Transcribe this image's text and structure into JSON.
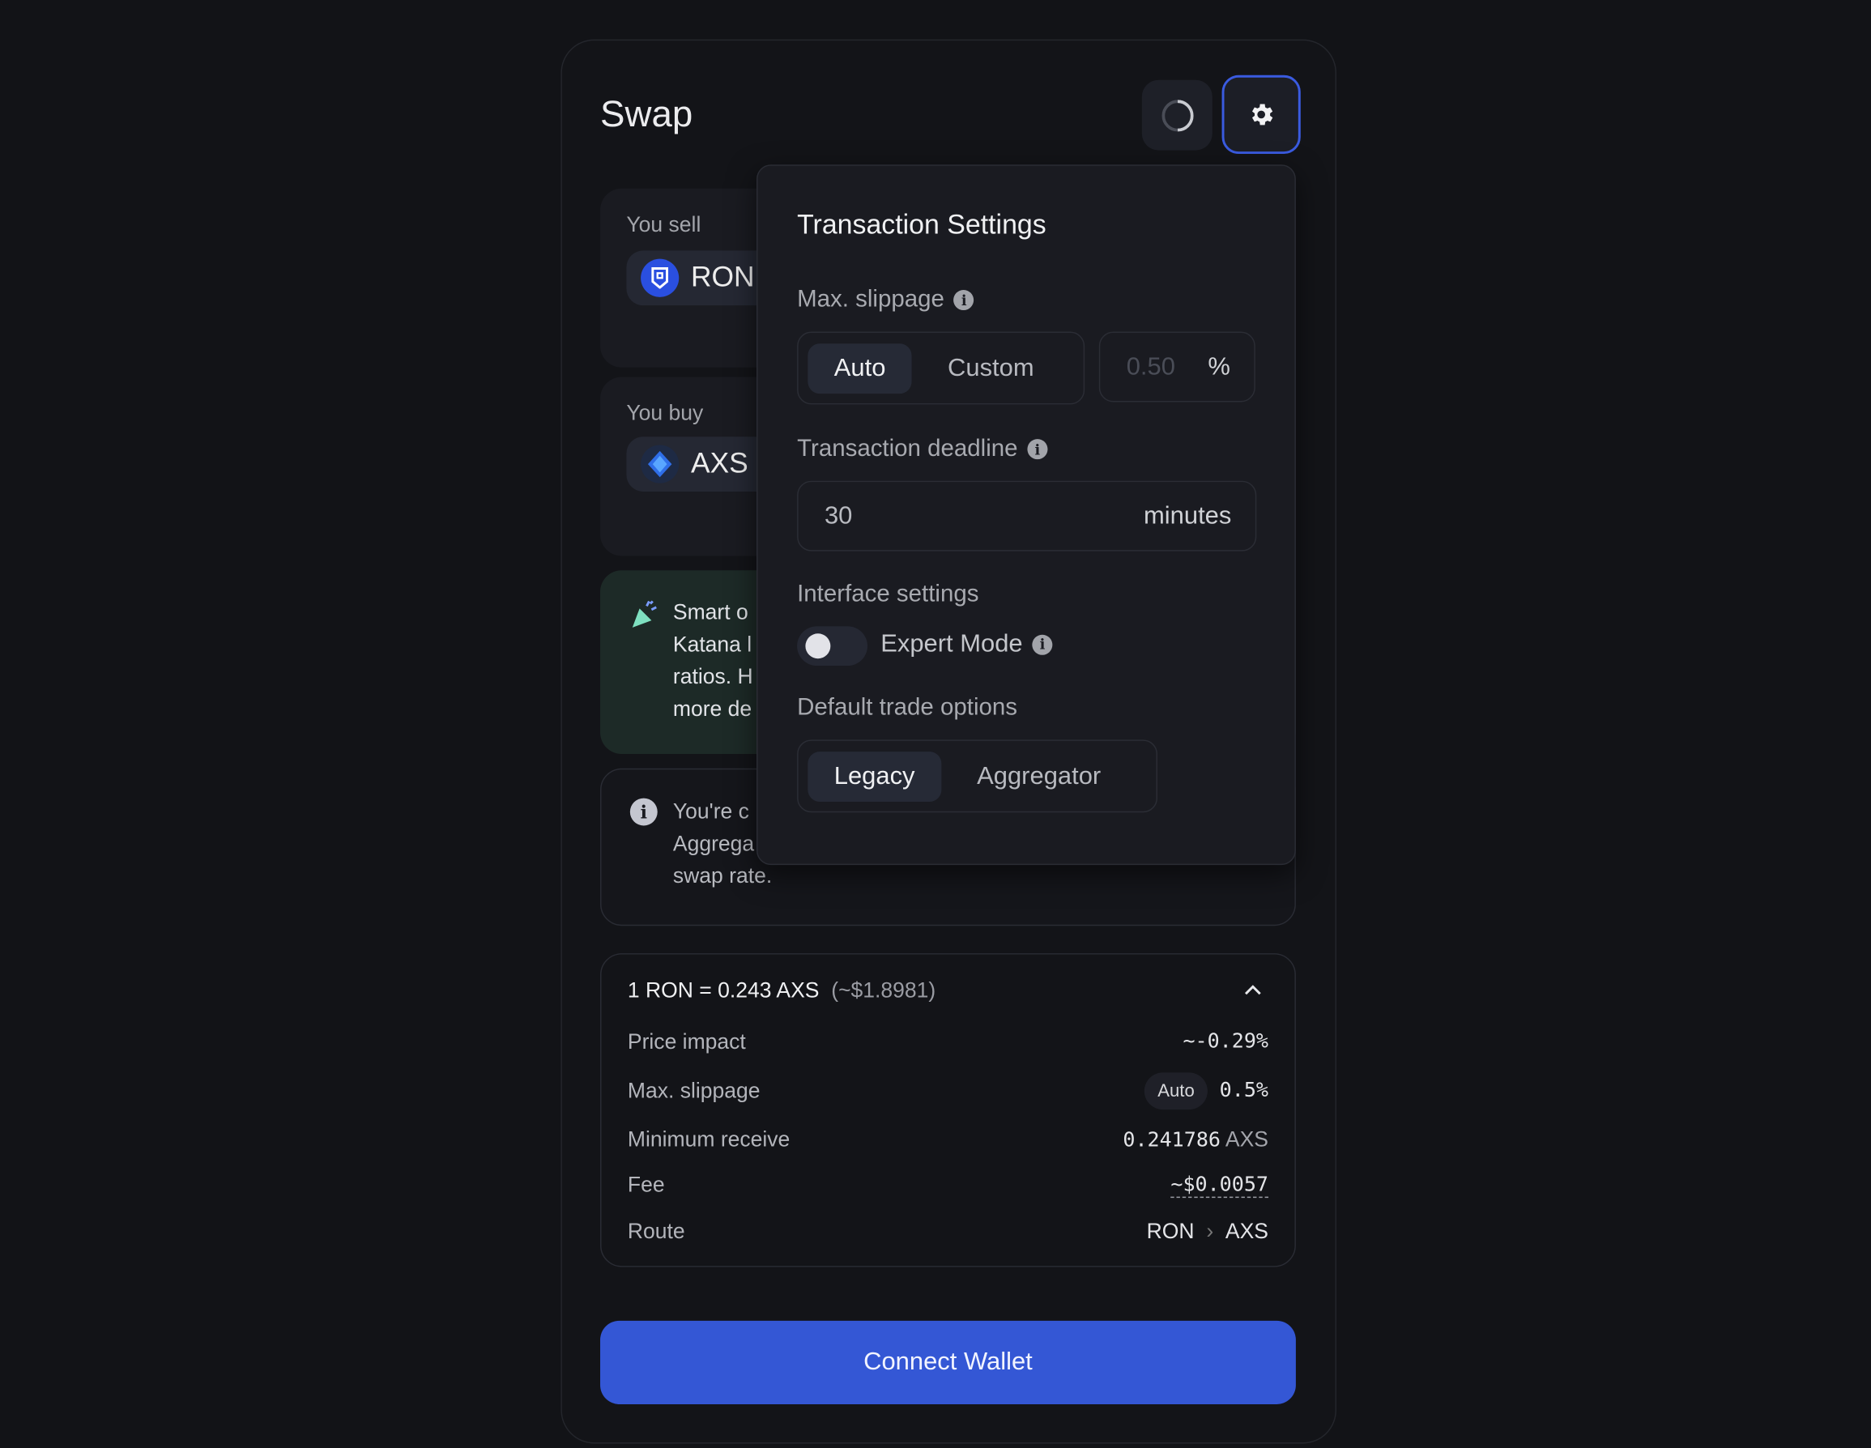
{
  "header": {
    "title": "Swap",
    "refresh_icon": "refresh-spinner-icon",
    "settings_icon": "gear-icon",
    "accent": "#3a5be0"
  },
  "sell": {
    "label": "You sell",
    "token": "RON",
    "token_color": "#2a4fe0"
  },
  "buy": {
    "label": "You buy",
    "token": "AXS",
    "token_color": "#2f6ee8"
  },
  "smart_banner": {
    "icon": "party-popper-icon",
    "lines": [
      "Smart o",
      "Katana l",
      "ratios. H",
      "more de"
    ]
  },
  "info_banner": {
    "icon": "info-icon",
    "lines": [
      "You're c",
      "Aggrega",
      "swap rate."
    ]
  },
  "settings": {
    "title": "Transaction Settings",
    "slippage": {
      "label": "Max. slippage",
      "options": [
        "Auto",
        "Custom"
      ],
      "selected": "Auto",
      "placeholder": "0.50",
      "unit": "%"
    },
    "deadline": {
      "label": "Transaction deadline",
      "value": "30",
      "unit": "minutes"
    },
    "interface": {
      "label": "Interface settings",
      "expert_mode": "Expert Mode",
      "expert_mode_on": false
    },
    "trade": {
      "label": "Default trade options",
      "options": [
        "Legacy",
        "Aggregator"
      ],
      "selected": "Legacy"
    }
  },
  "details": {
    "rate": "1 RON = 0.243 AXS",
    "rate_usd": "(~$1.8981)",
    "price_impact": {
      "label": "Price impact",
      "value": "~-0.29%"
    },
    "slippage": {
      "label": "Max. slippage",
      "badge": "Auto",
      "value": "0.5%"
    },
    "min_receive": {
      "label": "Minimum receive",
      "value": "0.241786",
      "unit": "AXS"
    },
    "fee": {
      "label": "Fee",
      "value": "~$0.0057"
    },
    "route": {
      "label": "Route",
      "from": "RON",
      "sep": "›",
      "to": "AXS"
    }
  },
  "connect_label": "Connect Wallet"
}
